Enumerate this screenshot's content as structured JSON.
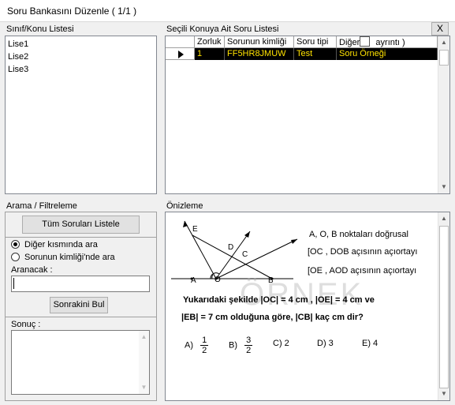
{
  "window": {
    "title": "Soru Bankasını Düzenle ( 1/1 )",
    "close_label": "X"
  },
  "class_list": {
    "header": "Sınıf/Konu Listesi",
    "items": [
      "Lise1",
      "Lise2",
      "Lise3"
    ]
  },
  "question_list": {
    "header": "Seçili Konuya Ait Soru Listesi",
    "columns": [
      "Zorluk",
      "Sorunun kimliği",
      "Soru tipi",
      "Diğer",
      "ayrıntı )"
    ],
    "rows": [
      {
        "difficulty": "1",
        "id": "FF5HR8JMUW",
        "type": "Test",
        "other": "Soru Örneği"
      }
    ]
  },
  "search": {
    "header": "Arama / Filtreleme",
    "list_all_button": "Tüm Soruları Listele",
    "radio_other": "Diğer kısmında ara",
    "radio_id": "Sorunun kimliği'nde ara",
    "search_label": "Aranacak :",
    "search_value": "",
    "find_next_button": "Sonrakini Bul",
    "result_label": "Sonuç :"
  },
  "preview": {
    "header": "Önizleme",
    "watermark": "ÖRNEK",
    "figure_labels": {
      "E": "E",
      "D": "D",
      "C": "C",
      "A": "A",
      "O": "O",
      "B": "B"
    },
    "given_1": "A, O, B noktaları doğrusal",
    "given_2": "[OC , DOB açısının açıortayı",
    "given_3": "[OE , AOD açısının açıortayı",
    "question_line1": "Yukarıdaki şekilde |OC| = 4 cm , |OE| = 4  cm  ve",
    "question_line2": "|EB| = 7 cm  olduğuna göre, |CB|  kaç cm dir?",
    "choices": {
      "a_label": "A)",
      "a_num": "1",
      "a_den": "2",
      "b_label": "B)",
      "b_num": "3",
      "b_den": "2",
      "c": "C) 2",
      "d": "D) 3",
      "e": "E) 4"
    }
  },
  "colors": {
    "selected_row_bg": "#000000",
    "selected_row_text": "#ffe200"
  },
  "icons": {
    "row_pointer": "triangle-right-icon",
    "scroll_up": "up-arrow-icon",
    "scroll_down": "down-arrow-icon"
  }
}
